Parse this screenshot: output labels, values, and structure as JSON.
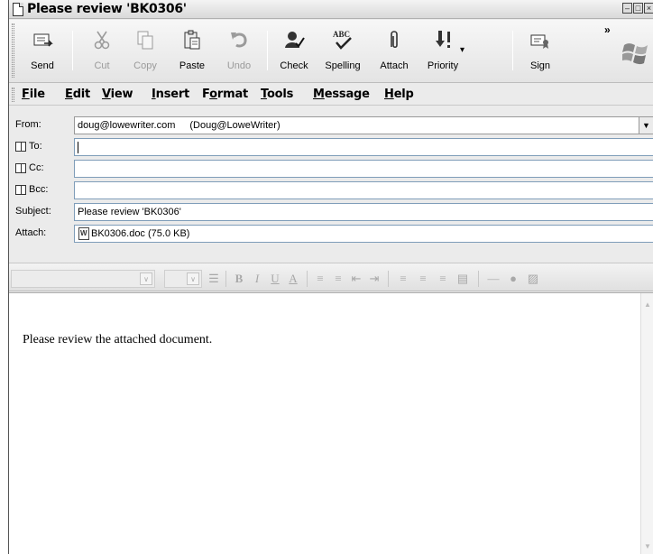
{
  "window": {
    "title": "Please review 'BK0306'"
  },
  "toolbar": {
    "buttons": [
      {
        "label": "Send",
        "icon": "send-icon",
        "enabled": true
      },
      {
        "label": "Cut",
        "icon": "cut-icon",
        "enabled": false
      },
      {
        "label": "Copy",
        "icon": "copy-icon",
        "enabled": false
      },
      {
        "label": "Paste",
        "icon": "paste-icon",
        "enabled": true
      },
      {
        "label": "Undo",
        "icon": "undo-icon",
        "enabled": false
      },
      {
        "label": "Check",
        "icon": "check-names-icon",
        "enabled": true
      },
      {
        "label": "Spelling",
        "icon": "spelling-icon",
        "enabled": true,
        "icon_text": "ABC"
      },
      {
        "label": "Attach",
        "icon": "paperclip-icon",
        "enabled": true
      },
      {
        "label": "Priority",
        "icon": "priority-icon",
        "enabled": true
      },
      {
        "label": "Sign",
        "icon": "sign-icon",
        "enabled": true
      }
    ],
    "overflow": "»"
  },
  "menu": {
    "items": [
      {
        "label": "File",
        "accel": "F"
      },
      {
        "label": "Edit",
        "accel": "E"
      },
      {
        "label": "View",
        "accel": "V"
      },
      {
        "label": "Insert",
        "accel": "I"
      },
      {
        "label": "Format",
        "accel": "o"
      },
      {
        "label": "Tools",
        "accel": "T"
      },
      {
        "label": "Message",
        "accel": "M"
      },
      {
        "label": "Help",
        "accel": "H"
      }
    ]
  },
  "header": {
    "from_label": "From:",
    "from_email": "doug@lowewriter.com",
    "from_name": "(Doug@LoweWriter)",
    "to_label": "To:",
    "to_value": "",
    "cc_label": "Cc:",
    "cc_value": "",
    "bcc_label": "Bcc:",
    "bcc_value": "",
    "subject_label": "Subject:",
    "subject_value": "Please review 'BK0306'",
    "attach_label": "Attach:",
    "attachment": "BK0306.doc (75.0 KB)"
  },
  "body": {
    "text": "Please review the attached document."
  }
}
